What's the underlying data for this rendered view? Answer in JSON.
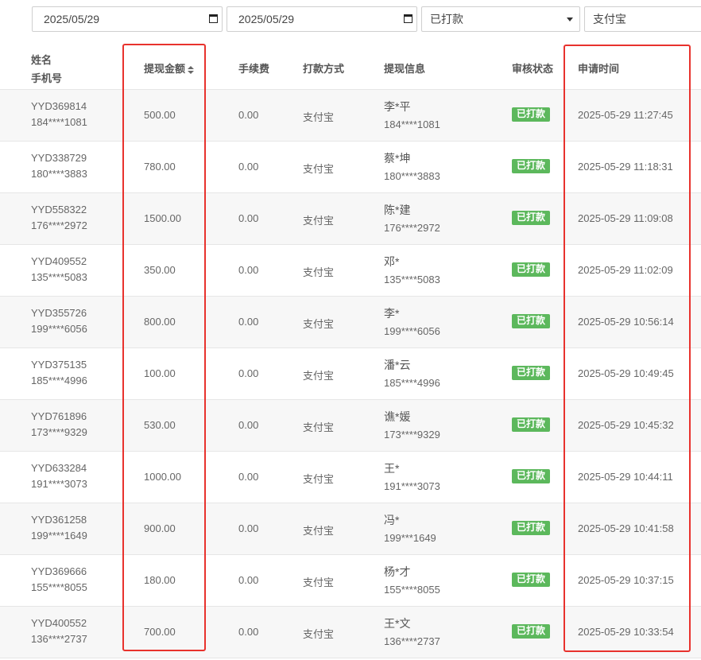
{
  "filters": {
    "start_date": "2025/05/29",
    "end_date": "2025/05/29",
    "status": "已打款",
    "method": "支付宝"
  },
  "columns": {
    "name": "姓名",
    "phone": "手机号",
    "amount": "提现金额",
    "fee": "手续费",
    "method": "打款方式",
    "info": "提现信息",
    "status": "审核状态",
    "time": "申请时间"
  },
  "rows": [
    {
      "user_id": "YYD369814",
      "phone": "184****1081",
      "amount": "500.00",
      "fee": "0.00",
      "method": "支付宝",
      "info_name": "李*平",
      "info_phone": "184****1081",
      "status": "已打款",
      "time": "2025-05-29 11:27:45"
    },
    {
      "user_id": "YYD338729",
      "phone": "180****3883",
      "amount": "780.00",
      "fee": "0.00",
      "method": "支付宝",
      "info_name": "蔡*坤",
      "info_phone": "180****3883",
      "status": "已打款",
      "time": "2025-05-29 11:18:31"
    },
    {
      "user_id": "YYD558322",
      "phone": "176****2972",
      "amount": "1500.00",
      "fee": "0.00",
      "method": "支付宝",
      "info_name": "陈*建",
      "info_phone": "176****2972",
      "status": "已打款",
      "time": "2025-05-29 11:09:08"
    },
    {
      "user_id": "YYD409552",
      "phone": "135****5083",
      "amount": "350.00",
      "fee": "0.00",
      "method": "支付宝",
      "info_name": "邓*",
      "info_phone": "135****5083",
      "status": "已打款",
      "time": "2025-05-29 11:02:09"
    },
    {
      "user_id": "YYD355726",
      "phone": "199****6056",
      "amount": "800.00",
      "fee": "0.00",
      "method": "支付宝",
      "info_name": "李*",
      "info_phone": "199****6056",
      "status": "已打款",
      "time": "2025-05-29 10:56:14"
    },
    {
      "user_id": "YYD375135",
      "phone": "185****4996",
      "amount": "100.00",
      "fee": "0.00",
      "method": "支付宝",
      "info_name": "潘*云",
      "info_phone": "185****4996",
      "status": "已打款",
      "time": "2025-05-29 10:49:45"
    },
    {
      "user_id": "YYD761896",
      "phone": "173****9329",
      "amount": "530.00",
      "fee": "0.00",
      "method": "支付宝",
      "info_name": "谯*媛",
      "info_phone": "173****9329",
      "status": "已打款",
      "time": "2025-05-29 10:45:32"
    },
    {
      "user_id": "YYD633284",
      "phone": "191****3073",
      "amount": "1000.00",
      "fee": "0.00",
      "method": "支付宝",
      "info_name": "王*",
      "info_phone": "191****3073",
      "status": "已打款",
      "time": "2025-05-29 10:44:11"
    },
    {
      "user_id": "YYD361258",
      "phone": "199****1649",
      "amount": "900.00",
      "fee": "0.00",
      "method": "支付宝",
      "info_name": "冯*",
      "info_phone": "199***1649",
      "status": "已打款",
      "time": "2025-05-29 10:41:58"
    },
    {
      "user_id": "YYD369666",
      "phone": "155****8055",
      "amount": "180.00",
      "fee": "0.00",
      "method": "支付宝",
      "info_name": "杨*才",
      "info_phone": "155****8055",
      "status": "已打款",
      "time": "2025-05-29 10:37:15"
    },
    {
      "user_id": "YYD400552",
      "phone": "136****2737",
      "amount": "700.00",
      "fee": "0.00",
      "method": "支付宝",
      "info_name": "王*文",
      "info_phone": "136****2737",
      "status": "已打款",
      "time": "2025-05-29 10:33:54"
    }
  ],
  "colors": {
    "status_badge": "#5cb85c",
    "highlight_box": "#e8322d"
  }
}
